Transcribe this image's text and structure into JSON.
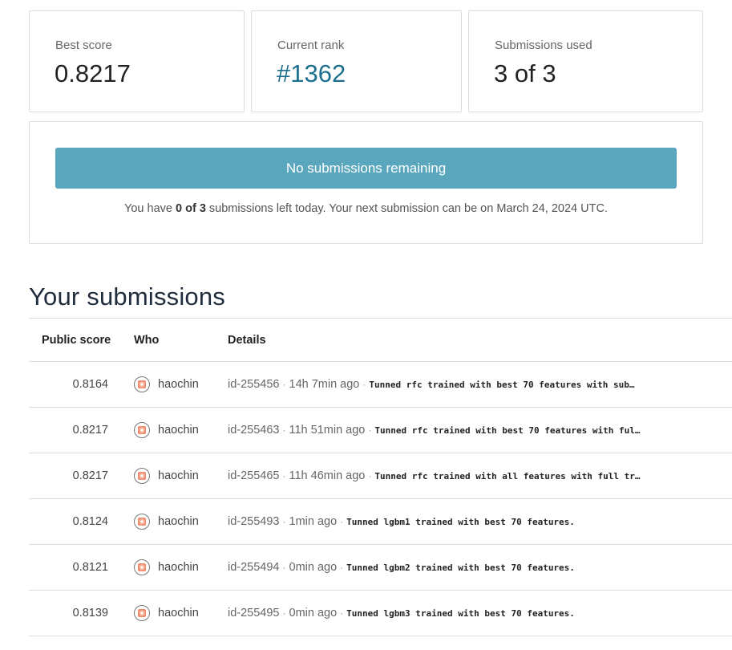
{
  "stats": {
    "best_score_label": "Best score",
    "best_score_value": "0.8217",
    "rank_label": "Current rank",
    "rank_value": "#1362",
    "submissions_label": "Submissions used",
    "submissions_value": "3 of 3"
  },
  "submit": {
    "button_label": "No submissions remaining",
    "note_prefix": "You have",
    "note_count": "0 of 3",
    "note_suffix": "submissions left today. Your next submission can be on March 24, 2024 UTC."
  },
  "submissions": {
    "title": "Your submissions",
    "columns": {
      "score": "Public score",
      "who": "Who",
      "details": "Details"
    },
    "separator": "·",
    "rows": [
      {
        "score": "0.8164",
        "who": "haochin",
        "id": "id-255456",
        "time": "14h 7min ago",
        "desc": "Tunned rfc trained with best 70 features with sub…"
      },
      {
        "score": "0.8217",
        "who": "haochin",
        "id": "id-255463",
        "time": "11h 51min ago",
        "desc": "Tunned rfc trained with best 70 features with ful…"
      },
      {
        "score": "0.8217",
        "who": "haochin",
        "id": "id-255465",
        "time": "11h 46min ago",
        "desc": "Tunned rfc trained with all features with full tr…"
      },
      {
        "score": "0.8124",
        "who": "haochin",
        "id": "id-255493",
        "time": "1min ago",
        "desc": "Tunned lgbm1 trained with best 70 features."
      },
      {
        "score": "0.8121",
        "who": "haochin",
        "id": "id-255494",
        "time": "0min ago",
        "desc": "Tunned lgbm2 trained with best 70 features."
      },
      {
        "score": "0.8139",
        "who": "haochin",
        "id": "id-255495",
        "time": "0min ago",
        "desc": "Tunned lgbm3 trained with best 70 features."
      }
    ]
  },
  "colors": {
    "button": "#5aa7bd",
    "rank": "#1d6f8e",
    "avatar": "#f08a6c"
  }
}
